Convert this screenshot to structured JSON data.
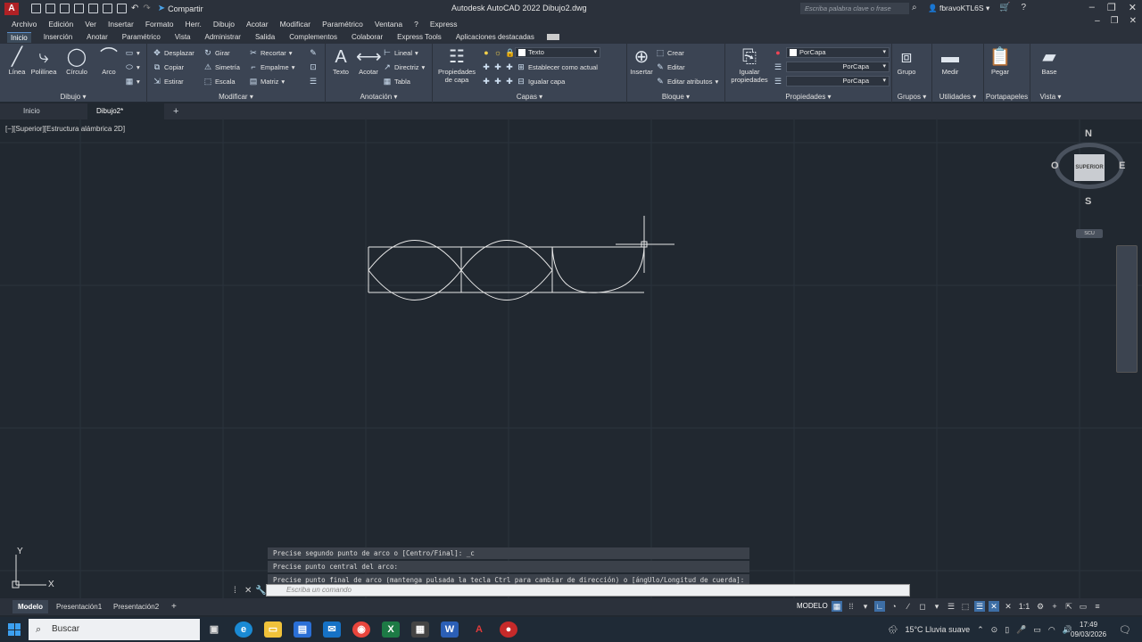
{
  "titlebar": {
    "logo": "A",
    "share": "Compartir",
    "title": "Autodesk AutoCAD 2022    Dibujo2.dwg",
    "search_placeholder": "Escriba palabra clave o frase",
    "user": "fbravoKTL6S",
    "window_buttons": [
      "–",
      "❐",
      "✕"
    ]
  },
  "menubar": [
    "Archivo",
    "Edición",
    "Ver",
    "Insertar",
    "Formato",
    "Herr.",
    "Dibujo",
    "Acotar",
    "Modificar",
    "Paramétrico",
    "Ventana",
    "?",
    "Express"
  ],
  "ribbon_tabs": [
    "Inicio",
    "Inserción",
    "Anotar",
    "Paramétrico",
    "Vista",
    "Administrar",
    "Salida",
    "Complementos",
    "Colaborar",
    "Express Tools",
    "Aplicaciones destacadas"
  ],
  "ribbon": {
    "dibujo": {
      "title": "Dibujo",
      "linea": "Línea",
      "polilinea": "Polilínea",
      "circulo": "Círculo",
      "arco": "Arco"
    },
    "modificar": {
      "title": "Modificar",
      "desplazar": "Desplazar",
      "girar": "Girar",
      "recortar": "Recortar",
      "copiar": "Copiar",
      "simetria": "Simetría",
      "empalme": "Empalme",
      "estirar": "Estirar",
      "escala": "Escala",
      "matriz": "Matriz"
    },
    "anotacion": {
      "title": "Anotación",
      "texto": "Texto",
      "acotar": "Acotar",
      "lineal": "Lineal",
      "directriz": "Directriz",
      "tabla": "Tabla"
    },
    "capas": {
      "title": "Capas",
      "propiedades_l1": "Propiedades",
      "propiedades_l2": "de capa",
      "layer_combo": "Texto",
      "establecer": "Establecer como actual",
      "igualar": "Igualar capa"
    },
    "bloque": {
      "title": "Bloque",
      "insertar": "Insertar",
      "crear": "Crear",
      "editar": "Editar",
      "editar_atributos": "Editar atributos"
    },
    "propiedades": {
      "title": "Propiedades",
      "igualar_l1": "Igualar",
      "igualar_l2": "propiedades",
      "color": "PorCapa",
      "linetype": "PorCapa",
      "lineweight": "PorCapa"
    },
    "grupos": {
      "title": "Grupos",
      "grupo": "Grupo"
    },
    "utilidades": {
      "title": "Utilidades",
      "medir": "Medir"
    },
    "portapapeles": {
      "title": "Portapapeles",
      "pegar": "Pegar"
    },
    "vista": {
      "title": "Vista",
      "base": "Base"
    }
  },
  "file_tabs": {
    "home": "Inicio",
    "drawing": "Dibujo2*",
    "close": "✕",
    "add": "+"
  },
  "viewport": {
    "label": "[−][Superior][Estructura alámbrica 2D]",
    "viewcube": {
      "n": "N",
      "s": "S",
      "e": "E",
      "w": "O",
      "face": "SUPERIOR",
      "wcs": "SCU"
    }
  },
  "ucs": {
    "y": "Y",
    "x": "X"
  },
  "command": {
    "history": [
      "Precise segundo punto de arco o [Centro/Final]: _c",
      "Precise punto central del arco:",
      "Precise punto final de arco (mantenga pulsada la tecla Ctrl para cambiar de dirección) o [ángUlo/Longitud de cuerda]:"
    ],
    "placeholder": "Escriba un comando"
  },
  "layout_tabs": [
    "Modelo",
    "Presentación1",
    "Presentación2",
    "+"
  ],
  "status": {
    "model": "MODELO",
    "scale": "1:1"
  },
  "taskbar": {
    "search": "Buscar",
    "weather": "15°C  Lluvia suave",
    "time": "17:49",
    "date": "09/03/2026"
  }
}
